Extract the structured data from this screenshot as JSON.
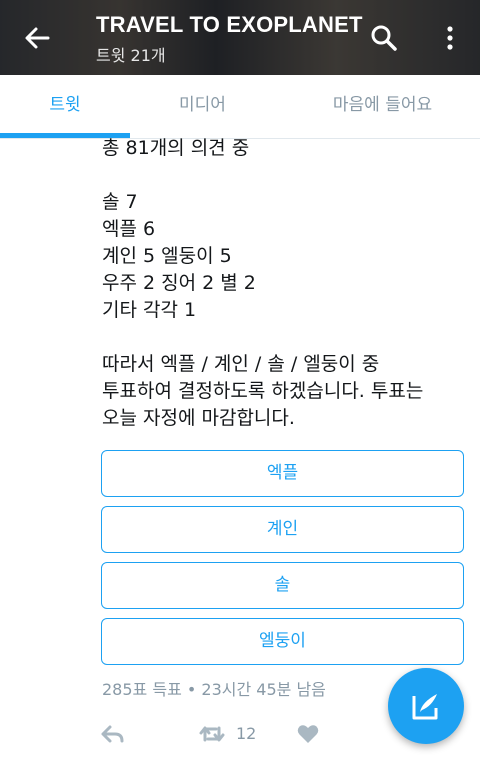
{
  "header": {
    "title": "TRAVEL TO EXOPLANET",
    "subtitle": "트윗 21개",
    "icons": [
      "back-arrow-icon",
      "search-icon",
      "more-vertical-icon"
    ]
  },
  "tabs": [
    {
      "label": "트윗",
      "active": true
    },
    {
      "label": "미디어",
      "active": false
    },
    {
      "label": "마음에 들어요",
      "active": false
    }
  ],
  "tweet": {
    "lines": [
      "총 81개의 의견 중",
      "",
      "솔 7",
      "엑플 6",
      "계인 5 엘둥이 5",
      "우주 2 징어 2 별 2",
      "기타 각각 1",
      "",
      "따라서 엑플 / 계인 / 솔 / 엘둥이 중",
      "투표하여 결정하도록 하겠습니다. 투표는",
      "오늘 자정에 마감합니다."
    ]
  },
  "poll": {
    "options": [
      "엑플",
      "계인",
      "솔",
      "엘둥이"
    ],
    "meta": "285표 득표 • 23시간 45분 남음"
  },
  "actions": {
    "retweet_count": "12",
    "icons": [
      "reply-icon",
      "retweet-icon",
      "heart-icon"
    ]
  },
  "fab": {
    "icon": "compose-icon"
  },
  "colors": {
    "accent": "#1da1f2",
    "muted": "#8899a6"
  }
}
